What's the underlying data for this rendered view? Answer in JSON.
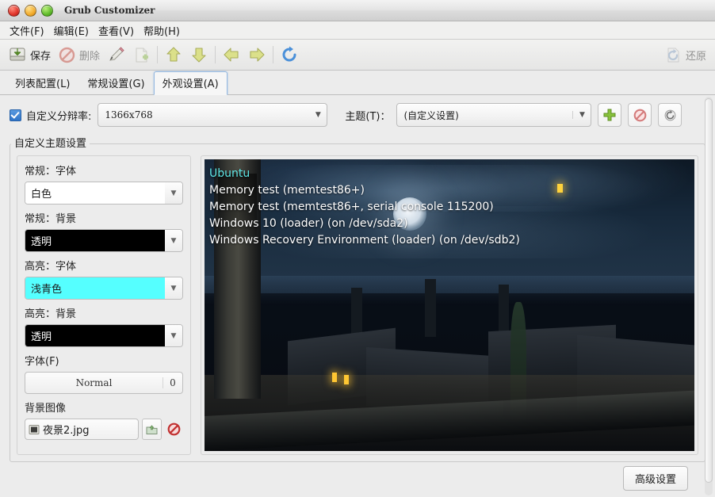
{
  "window": {
    "title": "Grub Customizer",
    "controls": {
      "close": "close-button",
      "minimize": "minimize-button",
      "maximize": "maximize-button"
    }
  },
  "menubar": {
    "items": [
      {
        "label": "文件(F)"
      },
      {
        "label": "编辑(E)"
      },
      {
        "label": "查看(V)"
      },
      {
        "label": "帮助(H)"
      }
    ]
  },
  "toolbar": {
    "save_label": "保存",
    "delete_label": "删除",
    "restore_label": "还原",
    "items": [
      {
        "name": "save",
        "label": "保存",
        "enabled": true
      },
      {
        "name": "delete",
        "label": "删除",
        "enabled": false
      },
      {
        "name": "edit",
        "label": "",
        "enabled": true
      },
      {
        "name": "new",
        "label": "",
        "enabled": false
      },
      {
        "name": "move-up",
        "label": "",
        "enabled": true
      },
      {
        "name": "move-down",
        "label": "",
        "enabled": true
      },
      {
        "name": "move-left",
        "label": "",
        "enabled": true
      },
      {
        "name": "move-right",
        "label": "",
        "enabled": true
      },
      {
        "name": "reload",
        "label": "",
        "enabled": true
      },
      {
        "name": "restore",
        "label": "还原",
        "enabled": false
      }
    ]
  },
  "tabs": [
    {
      "label": "列表配置(L)",
      "active": false
    },
    {
      "label": "常规设置(G)",
      "active": false
    },
    {
      "label": "外观设置(A)",
      "active": true
    }
  ],
  "toprow": {
    "custom_resolution_label": "自定义分辩率:",
    "custom_resolution_checked": true,
    "resolution_value": "1366x768",
    "theme_label": "主题(T)：",
    "theme_value": "(自定义设置)",
    "add_button": "add-theme-button",
    "remove_button": "remove-theme-button",
    "refresh_button": "refresh-theme-button"
  },
  "groupbox": {
    "title": "自定义主题设置",
    "fields": [
      {
        "label": "常规：字体",
        "value": "白色",
        "bg": "#ffffff",
        "fg": "#1c1c1c"
      },
      {
        "label": "常规：背景",
        "value": "透明",
        "bg": "#000000",
        "fg": "#ffffff"
      },
      {
        "label": "高亮：字体",
        "value": "浅青色",
        "bg": "#55ffff",
        "fg": "#1c1c1c"
      },
      {
        "label": "高亮：背景",
        "value": "透明",
        "bg": "#000000",
        "fg": "#ffffff"
      }
    ],
    "font_label": "字体(F)",
    "font_name": "Normal",
    "font_size": "0",
    "bgimage_label": "背景图像",
    "bgimage_file": "夜景2.jpg"
  },
  "preview": {
    "entries": [
      {
        "text": "Ubuntu",
        "selected": true
      },
      {
        "text": "Memory test (memtest86+)",
        "selected": false
      },
      {
        "text": "Memory test (memtest86+, serial console 115200)",
        "selected": false
      },
      {
        "text": "Windows 10 (loader) (on /dev/sda2)",
        "selected": false
      },
      {
        "text": "Windows Recovery Environment (loader) (on /dev/sdb2)",
        "selected": false
      }
    ],
    "highlight_color": "#5fe8e8",
    "normal_color": "#ffffff"
  },
  "footer": {
    "advanced_label": "高级设置"
  }
}
